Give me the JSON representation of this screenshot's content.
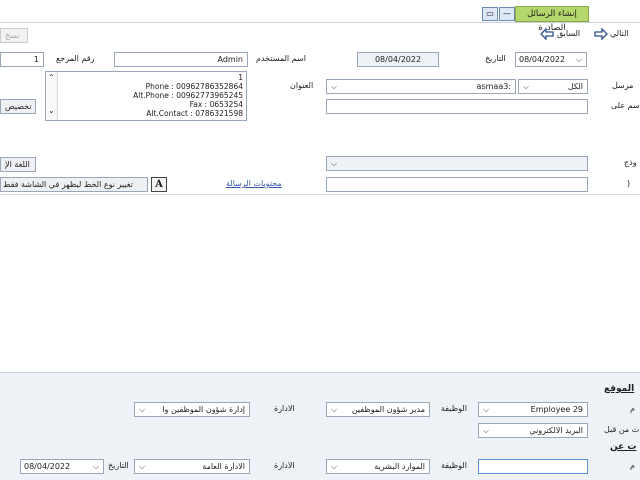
{
  "window": {
    "title": "إنشاء الرسائل الصادرة",
    "minimize_glyph": "—",
    "restore_glyph": "▭"
  },
  "toolbar": {
    "copy_label": "نسخ",
    "next_label": "التالي",
    "prev_label": "السابق"
  },
  "header": {
    "ref_label": "رقم المرجع",
    "ref_value": "1",
    "user_label": "اسم المستخدم",
    "user_value": "Admin",
    "date_label": "التاريخ",
    "date_value": "08/04/2022",
    "date_display": "08/04/2022"
  },
  "sender": {
    "label": "مرسل",
    "type_value": "الكل",
    "name_value": "asmaa3:"
  },
  "address": {
    "label": "العنوان",
    "lines": [
      "1",
      "Phone : 00962786352864",
      "Alt.Phone : 00962773965245",
      "Fax : 0653254",
      "Alt.Contact : 0786321598"
    ],
    "name_on_label": "اسم على"
  },
  "customize_button": "تخصيص",
  "template": {
    "label": "وذج",
    "lang_button": "اللغة الإ"
  },
  "message": {
    "contents_label": "محتويات الرسالة",
    "font_button": "تغيير نوع الخط ليظهر في الشاشة فقط",
    "font_icon_glyph": "A",
    "short_label": ")"
  },
  "signature": {
    "title": "الموقع",
    "name_label": "م",
    "name_value": "Employee 29",
    "job_label": "الوظيفة",
    "job_value": "مدير شؤون الموظفين",
    "dept_label": "الادارة",
    "dept_value": "إدارة شؤون الموظفين وا",
    "sent_by_label": "ت من قبل",
    "sent_by_value": "البريد الالكتروني"
  },
  "sent_to": {
    "title": "ت عن",
    "name_label": "م",
    "name_value": "",
    "job_label": "الوظيفة",
    "job_value": "الموارد البشرية",
    "dept_label": "الادارة",
    "dept_value": "الادارة العامة",
    "date_label": "التاريخ",
    "date_value": "08/04/2022"
  },
  "colors": {
    "title_tab": "#b5d66a",
    "bottom_panel": "#eef1f5",
    "arrow_blue": "#2f4f8f"
  }
}
